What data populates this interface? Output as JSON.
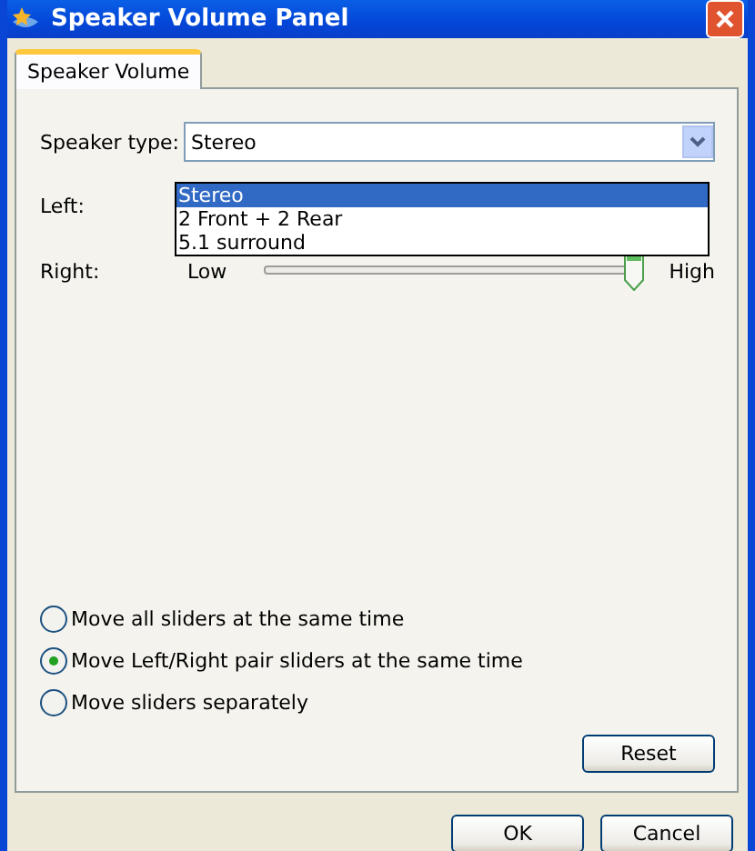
{
  "window": {
    "title": "Speaker Volume Panel"
  },
  "tabs": [
    {
      "label": "Speaker Volume",
      "selected": true
    }
  ],
  "speaker_type": {
    "label": "Speaker type:",
    "value": "Stereo",
    "expanded": true,
    "options": [
      {
        "label": "Stereo",
        "selected": true
      },
      {
        "label": "2 Front + 2 Rear",
        "selected": false
      },
      {
        "label": "5.1 surround",
        "selected": false
      }
    ]
  },
  "sliders": [
    {
      "label": "Left:"
    },
    {
      "label": "Right:",
      "low": "Low",
      "high": "High",
      "level": 1
    }
  ],
  "radios": [
    {
      "label": "Move all sliders at the same time",
      "selected": false
    },
    {
      "label": "Move Left/Right pair sliders at the same time",
      "selected": true
    },
    {
      "label": "Move sliders separately",
      "selected": false
    }
  ],
  "reset": "Reset",
  "buttons": [
    "OK",
    "Cancel"
  ]
}
